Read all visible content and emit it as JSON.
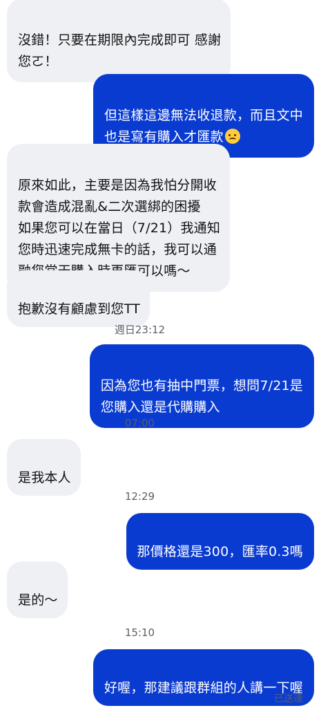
{
  "messages": [
    {
      "id": "m1",
      "from": "them",
      "text": "沒錯！只要在期限內完成即可 感謝\n您ㄛ！"
    },
    {
      "id": "m2",
      "from": "me",
      "text": "但這樣這邊無法收退款，而且文中\n也是寫有購入才匯款",
      "emoji": "emoji-hot-face"
    },
    {
      "id": "m3",
      "from": "them",
      "text": "原來如此，主要是因為我怕分開收\n款會造成混亂&二次選綁的困擾\n如果您可以在當日（7/21）我通知\n您時迅速完成無卡的話，我可以通\n融您當天購入時再匯可以嗎～"
    },
    {
      "id": "m4",
      "from": "them",
      "text": "抱歉沒有顧慮到您TT"
    },
    {
      "id": "m5",
      "from": "me",
      "text": "因為您也有抽中門票，想問7/21是\n您購入還是代購購入"
    },
    {
      "id": "m6",
      "from": "them",
      "text": "是我本人"
    },
    {
      "id": "m7",
      "from": "me",
      "text": "那價格還是300，匯率0.3嗎"
    },
    {
      "id": "m8",
      "from": "them",
      "text": "是的～"
    },
    {
      "id": "m9",
      "from": "me",
      "text": "好喔，那建議跟群組的人講一下喔"
    }
  ],
  "timestamps": [
    "週日23:12",
    "07:00",
    "12:29",
    "15:10"
  ],
  "status": "已送達",
  "colors": {
    "outgoing_bubble": "#0a3bd0",
    "incoming_bubble": "#eef0f4",
    "timestamp_text": "#5a5f66"
  }
}
